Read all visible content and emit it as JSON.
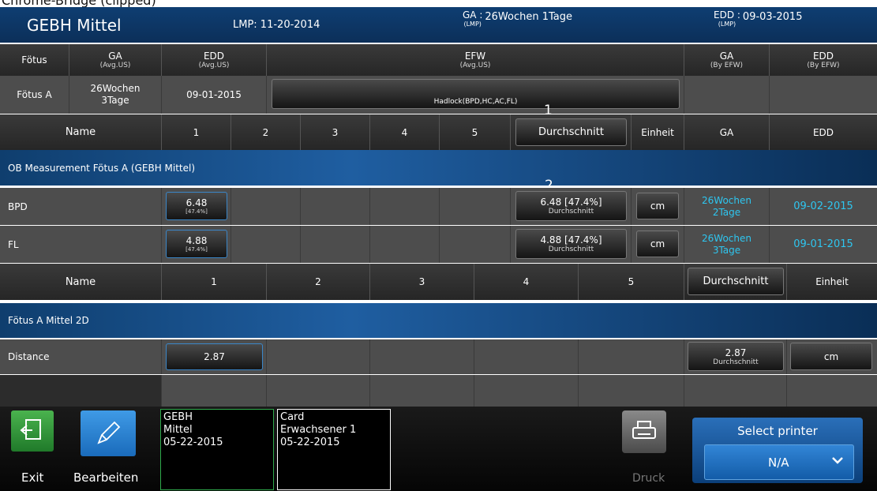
{
  "header": {
    "title": "GEBH Mittel",
    "lmp": "LMP: 11-20-2014",
    "ga_label": "GA :",
    "ga_sub": "(LMP)",
    "ga_value": "26Wochen 1Tage",
    "edd_label": "EDD :",
    "edd_sub": "(LMP)",
    "edd_value": "09-03-2015"
  },
  "summary": {
    "cols": {
      "foetus": "Fötus",
      "ga": "GA",
      "ga_sub": "(Avg.US)",
      "edd": "EDD",
      "edd_sub": "(Avg.US)",
      "efw": "EFW",
      "efw_sub": "(Avg.US)",
      "ga_efw": "GA",
      "ga_efw_sub": "(By EFW)",
      "edd_efw": "EDD",
      "edd_efw_sub": "(By EFW)"
    },
    "row": {
      "foetus": "Fötus A",
      "ga": "26Wochen 3Tage",
      "edd": "09-01-2015",
      "efw_method": "Hadlock(BPD,HC,AC,FL)"
    }
  },
  "ob_table": {
    "headers": {
      "name": "Name",
      "c1": "1",
      "c2": "2",
      "c3": "3",
      "c4": "4",
      "c5": "5",
      "avg": "Durchschnitt",
      "unit": "Einheit",
      "ga": "GA",
      "edd": "EDD"
    },
    "marker1": "1",
    "marker2": "2",
    "section_title": "OB Measurement Fötus A (GEBH Mittel)",
    "rows": [
      {
        "name": "BPD",
        "v1": "6.48",
        "v1_pct": "[47.4%]",
        "avg": "6.48 [47.4%]",
        "avg_sub": "Durchschnitt",
        "unit": "cm",
        "ga": "26Wochen 2Tage",
        "edd": "09-02-2015"
      },
      {
        "name": "FL",
        "v1": "4.88",
        "v1_pct": "[47.4%]",
        "avg": "4.88 [47.4%]",
        "avg_sub": "Durchschnitt",
        "unit": "cm",
        "ga": "26Wochen 3Tage",
        "edd": "09-01-2015"
      }
    ]
  },
  "twod_table": {
    "headers": {
      "name": "Name",
      "c1": "1",
      "c2": "2",
      "c3": "3",
      "c4": "4",
      "c5": "5",
      "avg": "Durchschnitt",
      "unit": "Einheit"
    },
    "section_title": "Fötus A Mittel 2D",
    "rows": [
      {
        "name": "Distance",
        "v1": "2.87",
        "avg": "2.87",
        "avg_sub": "Durchschnitt",
        "unit": "cm"
      }
    ]
  },
  "footer": {
    "exit": "Exit",
    "edit": "Bearbeiten",
    "card1": {
      "l1": "GEBH",
      "l2": "Mittel",
      "l3": "05-22-2015"
    },
    "card2": {
      "l1": "Card",
      "l2": "Erwachsener 1",
      "l3": "05-22-2015"
    },
    "print": "Druck",
    "select_printer": "Select printer",
    "printer_value": "N/A"
  },
  "colors": {
    "accent_blue": "#1f6cc0",
    "ga_text": "#2ec6f0",
    "green_border": "#2ea84a"
  }
}
